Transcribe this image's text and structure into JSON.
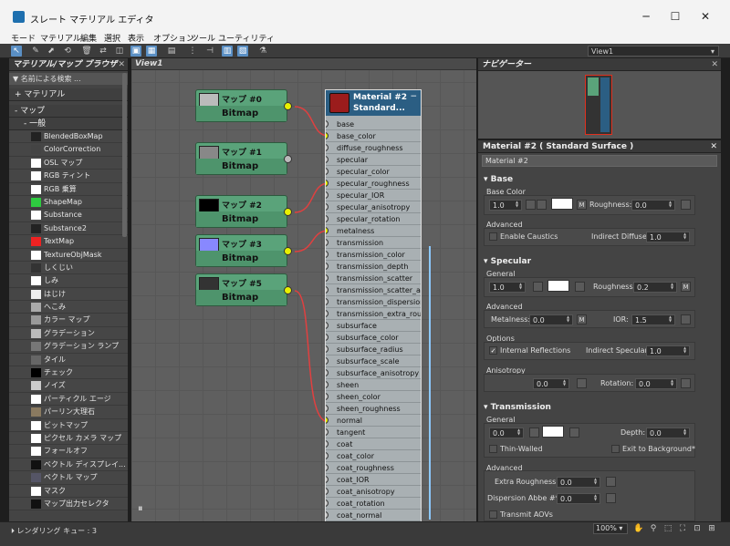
{
  "window": {
    "title": "スレート マテリアル エディタ",
    "minimize": "─",
    "maximize": "☐",
    "close": "✕"
  },
  "menu": [
    "モード",
    "マテリアル",
    "編集",
    "選択",
    "表示",
    "オプション",
    "ツール",
    "ユーティリティ"
  ],
  "toolbar": {
    "view_dropdown": "View1"
  },
  "browser": {
    "title": "マテリアル/マップ ブラウザ",
    "search_placeholder": "名前による検索 ...",
    "groups": {
      "materials": "+ マテリアル",
      "maps": "- マップ",
      "general": "- 一般"
    },
    "items": [
      "BlendedBoxMap",
      "ColorCorrection",
      "OSL マップ",
      "RGB ティント",
      "RGB 乗算",
      "ShapeMap",
      "Substance",
      "Substance2",
      "TextMap",
      "TextureObjMask",
      "しくじい",
      "しみ",
      "はじけ",
      "へこみ",
      "カラー マップ",
      "グラデーション",
      "グラデーション ランプ",
      "タイル",
      "チェック",
      "ノイズ",
      "パーティクル エージ",
      "パーリン大理石",
      "ビットマップ",
      "ピクセル カメラ マップ",
      "フォールオフ",
      "ベクトル ディスプレイ...",
      "ベクトル マップ",
      "マスク",
      "マップ出力セレクタ"
    ]
  },
  "graph": {
    "tab": "View1",
    "nodes": [
      {
        "name": "マップ #0",
        "type": "Bitmap"
      },
      {
        "name": "マップ #1",
        "type": "Bitmap"
      },
      {
        "name": "マップ #2",
        "type": "Bitmap"
      },
      {
        "name": "マップ #3",
        "type": "Bitmap"
      },
      {
        "name": "マップ #5",
        "type": "Bitmap"
      }
    ],
    "material": {
      "title1": "Material #2",
      "title2": "Standard...",
      "slots": [
        "base",
        "base_color",
        "diffuse_roughness",
        "specular",
        "specular_color",
        "specular_roughness",
        "specular_IOR",
        "specular_anisotropy",
        "specular_rotation",
        "metalness",
        "transmission",
        "transmission_color",
        "transmission_depth",
        "transmission_scatter",
        "transmission_scatter_ani...",
        "transmission_dispersion*",
        "transmission_extra_roug...",
        "subsurface",
        "subsurface_color",
        "subsurface_radius",
        "subsurface_scale",
        "subsurface_anisotropy",
        "sheen",
        "sheen_color",
        "sheen_roughness",
        "normal",
        "tangent",
        "coat",
        "coat_color",
        "coat_roughness",
        "coat_IOR",
        "coat_anisotropy",
        "coat_rotation",
        "coat_normal"
      ]
    }
  },
  "navigator": {
    "title": "ナビゲーター"
  },
  "params": {
    "title": "Material #2  ( Standard Surface )",
    "name": "Material #2",
    "base": {
      "header": "Base",
      "sub": "Base Color",
      "value": "1.0",
      "m": "M",
      "roughness_label": "Roughness:",
      "roughness": "0.0",
      "advanced": "Advanced",
      "enable_caustics": "Enable Caustics",
      "indirect_diffuse_label": "Indirect Diffuse:",
      "indirect_diffuse": "1.0"
    },
    "specular": {
      "header": "Specular",
      "general": "General",
      "value": "1.0",
      "roughness_label": "Roughness:",
      "roughness": "0.2",
      "m": "M",
      "advanced": "Advanced",
      "metalness_label": "Metalness:",
      "metalness": "0.0",
      "ior_label": "IOR:",
      "ior": "1.5",
      "options": "Options",
      "internal_reflections": "Internal Reflections",
      "indirect_specular_label": "Indirect Specular:",
      "indirect_specular": "1.0",
      "anisotropy_header": "Anisotropy",
      "anisotropy": "0.0",
      "rotation_label": "Rotation:",
      "rotation": "0.0"
    },
    "transmission": {
      "header": "Transmission",
      "general": "General",
      "value": "0.0",
      "depth_label": "Depth:",
      "depth": "0.0",
      "thin_walled": "Thin-Walled",
      "exit_to_background": "Exit to Background*",
      "advanced": "Advanced",
      "extra_roughness_label": "Extra Roughness:",
      "extra_roughness": "0.0",
      "dispersion_label": "Dispersion Abbe #*:",
      "dispersion": "0.0",
      "transmit_aovs": "Transmit AOVs"
    }
  },
  "status": {
    "text": "レンダリング キュー : 3",
    "zoom": "100%"
  }
}
